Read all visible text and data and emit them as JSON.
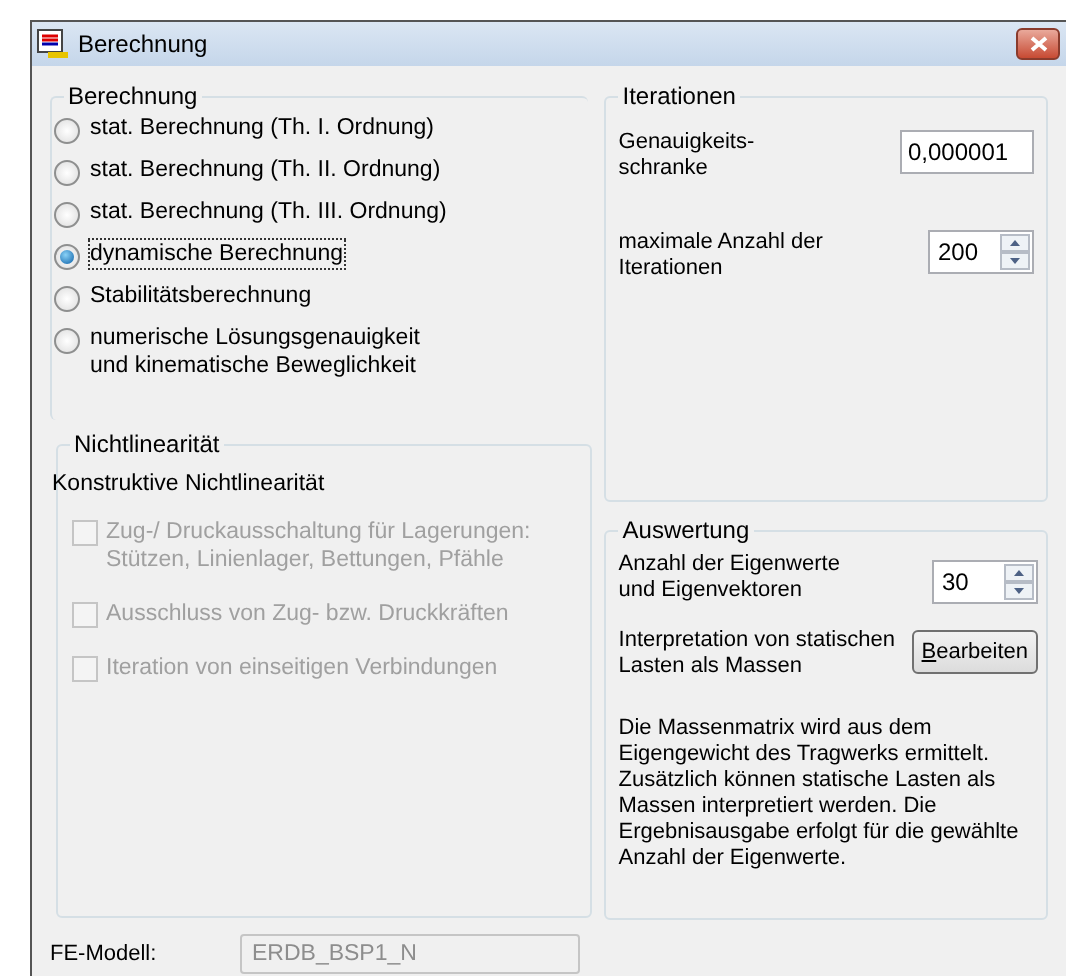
{
  "window": {
    "title": "Berechnung"
  },
  "berechnung": {
    "title": "Berechnung",
    "options": [
      {
        "label": "stat. Berechnung (Th. I. Ordnung)",
        "selected": false
      },
      {
        "label": "stat. Berechnung (Th. II. Ordnung)",
        "selected": false
      },
      {
        "label": "stat. Berechnung (Th. III. Ordnung)",
        "selected": false
      },
      {
        "label": "dynamische Berechnung",
        "selected": true
      },
      {
        "label": "Stabilitätsberechnung",
        "selected": false
      },
      {
        "label": "numerische Lösungsgenauigkeit\nund kinematische Beweglichkeit",
        "selected": false
      }
    ]
  },
  "nichtlinearitaet": {
    "title": "Nichtlinearität",
    "subtitle": "Konstruktive Nichtlinearität",
    "options": [
      {
        "label": "Zug-/ Druckausschaltung für Lagerungen:\nStützen, Linienlager, Bettungen, Pfähle",
        "checked": false,
        "disabled": true
      },
      {
        "label": "Ausschluss von Zug- bzw. Druckkräften",
        "checked": false,
        "disabled": true
      },
      {
        "label": "Iteration von einseitigen Verbindungen",
        "checked": false,
        "disabled": true
      }
    ]
  },
  "fe_modell": {
    "label": "FE-Modell:",
    "value": "ERDB_BSP1_N"
  },
  "iterationen": {
    "title": "Iterationen",
    "fields": [
      {
        "kind": "text",
        "label": "Genauigkeits-\nschranke",
        "value": "0,000001"
      },
      {
        "kind": "spin",
        "label": "maximale Anzahl der\nIterationen",
        "value": "200"
      }
    ]
  },
  "auswertung": {
    "title": "Auswertung",
    "eigen_label": "Anzahl der Eigenwerte\nund Eigenvektoren",
    "eigen_value": "30",
    "interp_label": "Interpretation von statischen\nLasten als Massen",
    "button": "Bearbeiten",
    "note": "Die Massenmatrix wird aus dem Eigengewicht des Tragwerks ermittelt. Zusätzlich können statische Lasten als Massen interpretiert werden. Die Ergebnisausgabe erfolgt für die gewählte Anzahl der Eigenwerte."
  }
}
